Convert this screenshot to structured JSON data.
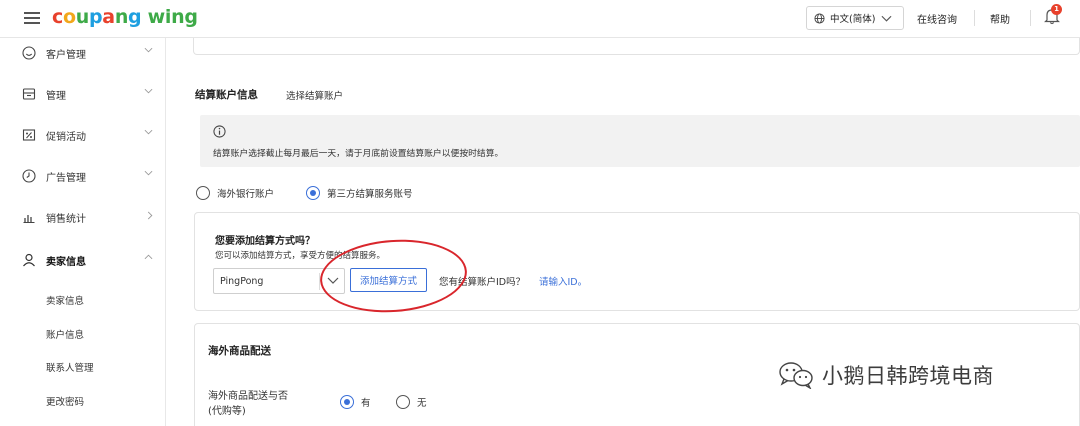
{
  "header": {
    "logo": [
      "c",
      "o",
      "u",
      "p",
      "a",
      "n",
      "g",
      " wing"
    ],
    "language": "中文(简体)",
    "online_consult": "在线咨询",
    "help": "帮助",
    "notification_count": "1"
  },
  "sidebar": {
    "items": [
      {
        "label": "客户管理",
        "icon": "smile-icon"
      },
      {
        "label": "管理",
        "icon": "store-icon"
      },
      {
        "label": "促销活动",
        "icon": "promo-icon"
      },
      {
        "label": "广告管理",
        "icon": "clock-icon"
      },
      {
        "label": "销售统计",
        "icon": "bar-chart-icon"
      },
      {
        "label": "卖家信息",
        "icon": "user-icon"
      }
    ],
    "sub_items": [
      "卖家信息",
      "账户信息",
      "联系人管理",
      "更改密码"
    ]
  },
  "settlement": {
    "title": "结算账户信息",
    "subtitle": "选择结算账户",
    "notice": "结算账户选择截止每月最后一天，请于月底前设置结算账户以便按时结算。",
    "option_overseas": "海外银行账户",
    "option_third_party": "第三方结算服务账号",
    "selected": "third_party"
  },
  "payment_method": {
    "question": "您要添加结算方式吗？",
    "hint": "您可以添加结算方式，享受方便的结算服务。",
    "selected_provider": "PingPong",
    "add_button": "添加结算方式",
    "account_question": "您有结算账户ID吗？",
    "enter_id_link": "请输入ID。"
  },
  "overseas_shipping": {
    "title": "海外商品配送",
    "label_line1": "海外商品配送与否",
    "label_line2": "(代购等)",
    "option_yes": "有",
    "option_no": "无",
    "selected": "yes"
  },
  "watermark": {
    "text": "小鹅日韩跨境电商"
  },
  "colors": {
    "accent": "#3a6fd8",
    "annotation_red": "#d9262c",
    "notice_bg": "#f2f2f2"
  }
}
